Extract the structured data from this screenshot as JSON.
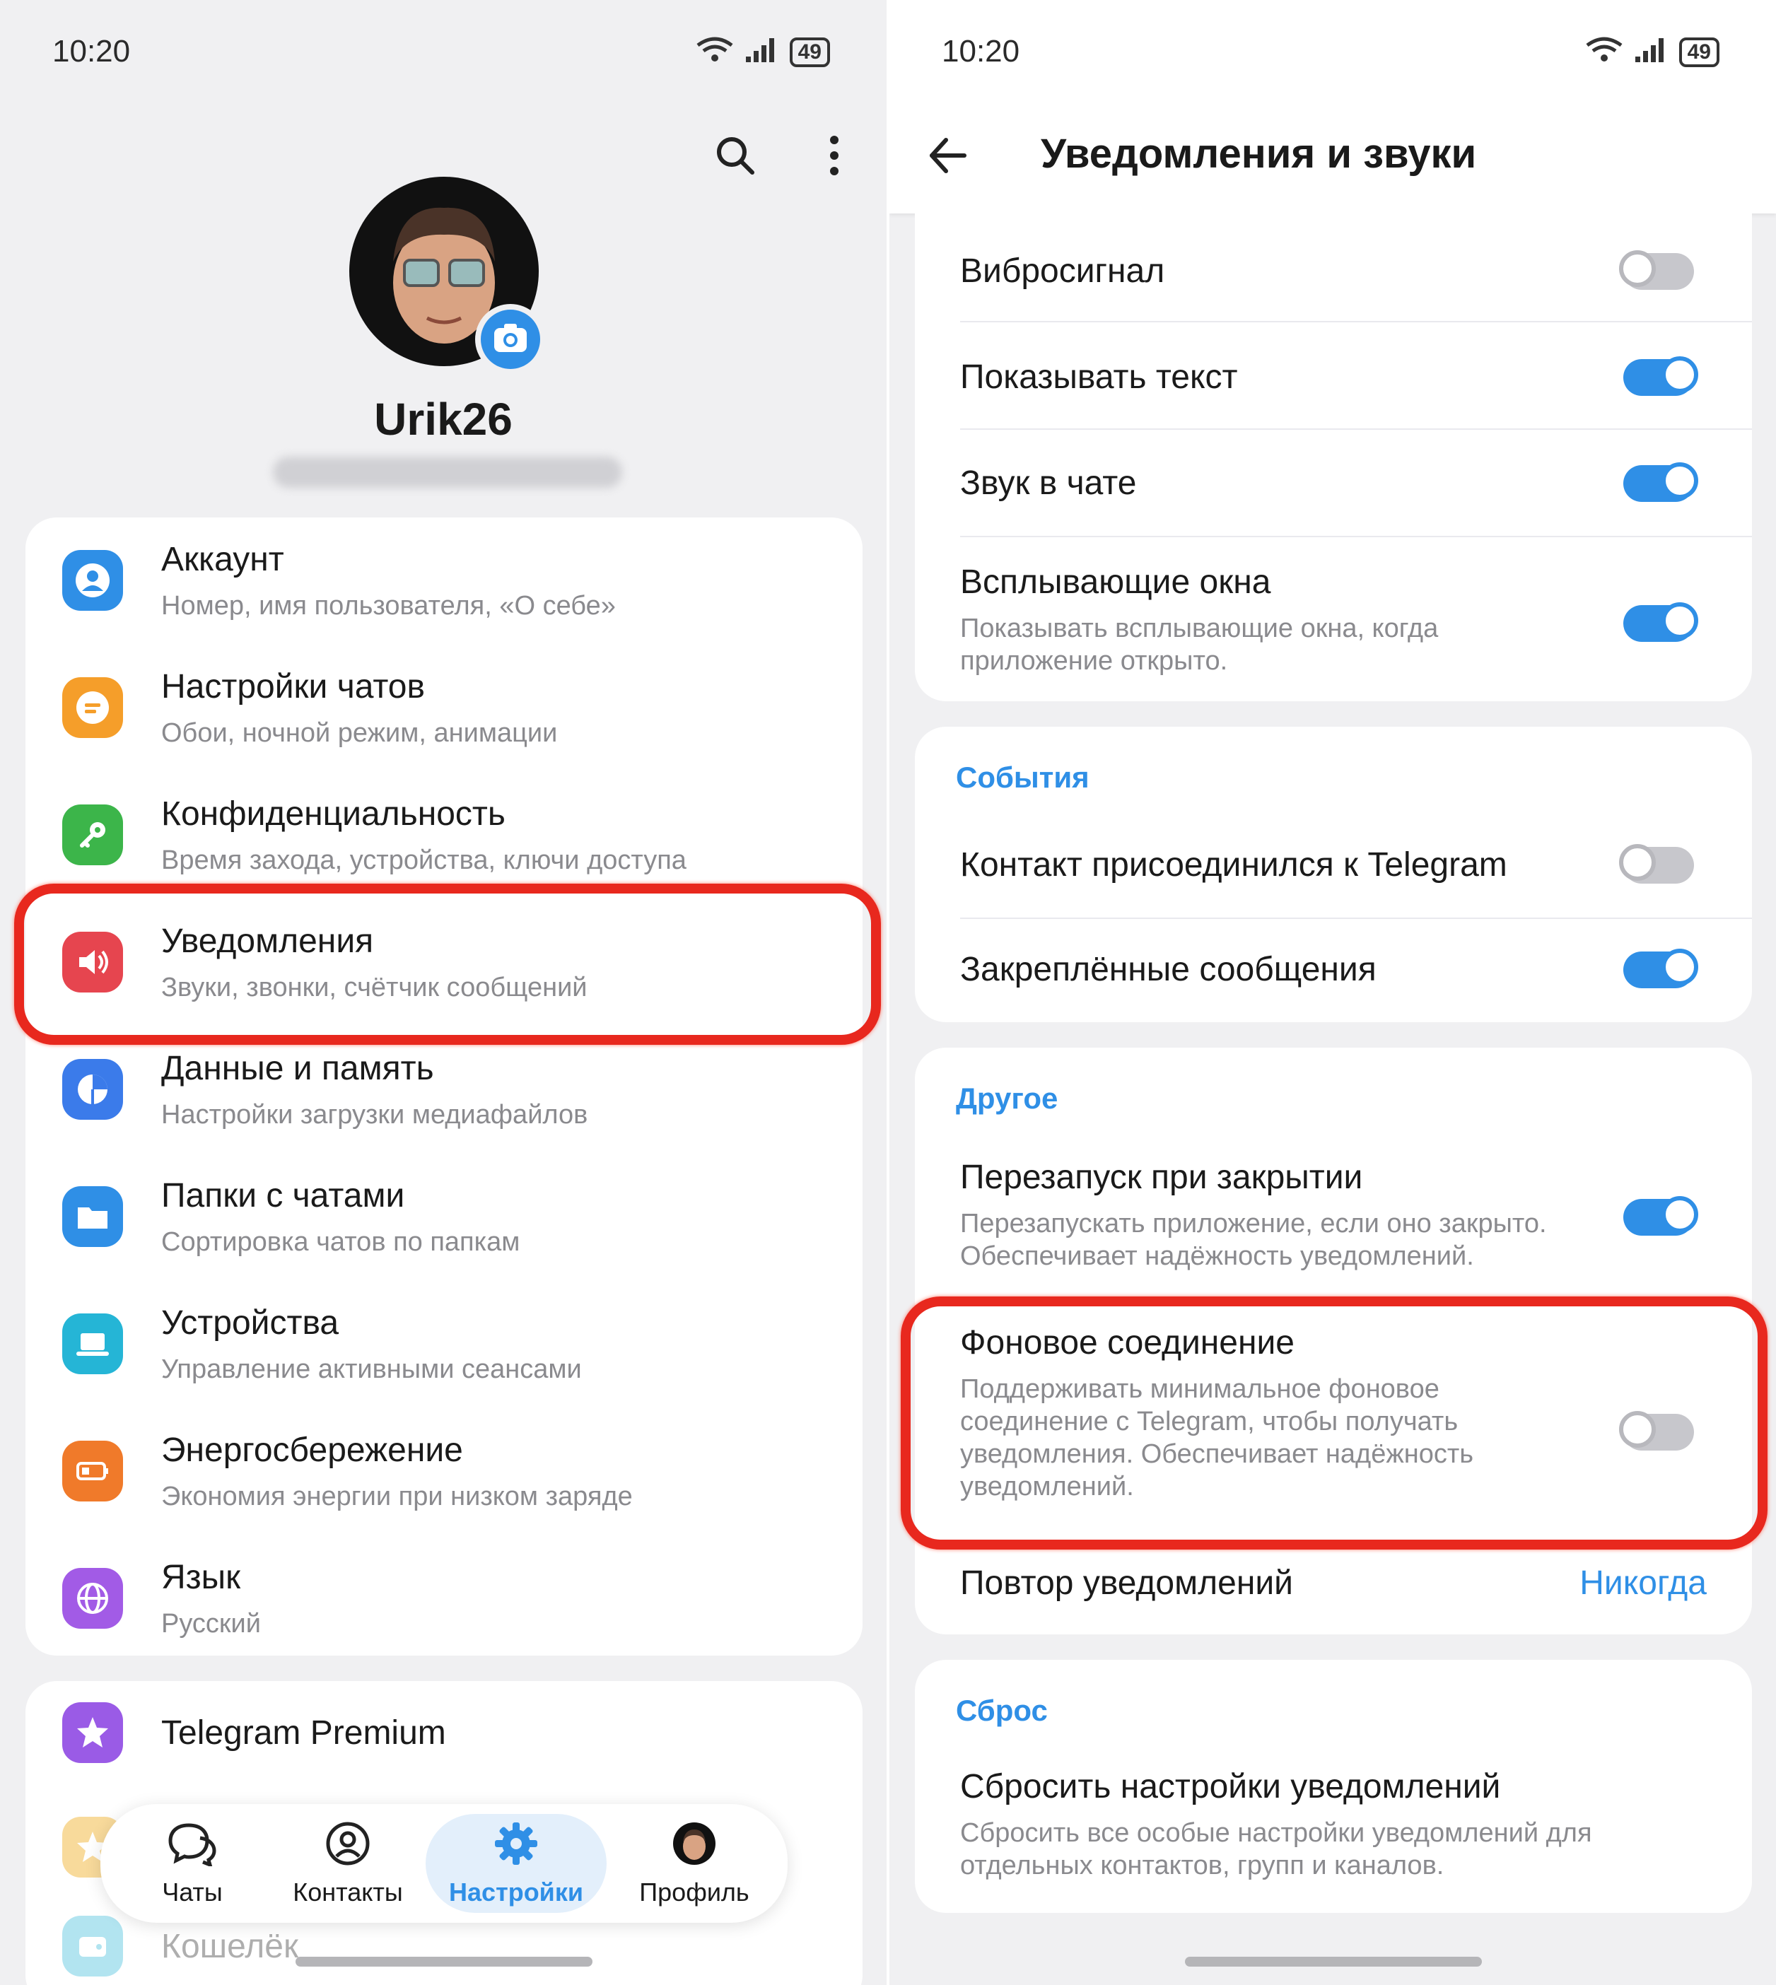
{
  "status_bar": {
    "time": "10:20",
    "battery": "49",
    "signal_label": "6"
  },
  "left": {
    "profile": {
      "name": "Urik26"
    },
    "settings_items": [
      {
        "title": "Аккаунт",
        "subtitle": "Номер, имя пользователя, «О себе»",
        "icon": "person-icon",
        "color": "#2f8fe6"
      },
      {
        "title": "Настройки чатов",
        "subtitle": "Обои, ночной режим, анимации",
        "icon": "chat-bubble-icon",
        "color": "#f59e2a"
      },
      {
        "title": "Конфиденциальность",
        "subtitle": "Время захода, устройства, ключи доступа",
        "icon": "key-icon",
        "color": "#3cb54a"
      },
      {
        "title": "Уведомления",
        "subtitle": "Звуки, звонки, счётчик сообщений",
        "icon": "speaker-icon",
        "color": "#e6454f"
      },
      {
        "title": "Данные и память",
        "subtitle": "Настройки загрузки медиафайлов",
        "icon": "pie-chart-icon",
        "color": "#3b7bea"
      },
      {
        "title": "Папки с чатами",
        "subtitle": "Сортировка чатов по папкам",
        "icon": "folder-icon",
        "color": "#2f8fe6"
      },
      {
        "title": "Устройства",
        "subtitle": "Управление активными сеансами",
        "icon": "laptop-icon",
        "color": "#25b5d6"
      },
      {
        "title": "Энергосбережение",
        "subtitle": "Экономия энергии при низком заряде",
        "icon": "battery-icon",
        "color": "#f07a2a"
      },
      {
        "title": "Язык",
        "subtitle": "Русский",
        "icon": "globe-icon",
        "color": "#a25be6"
      }
    ],
    "premium_items": [
      {
        "title": "Telegram Premium",
        "icon": "star-icon",
        "color": "#9a5be6"
      },
      {
        "title": "Кошелёк",
        "icon": "wallet-icon",
        "color": "#25b5d6"
      }
    ],
    "nav": {
      "items": [
        {
          "label": "Чаты",
          "icon": "chats-icon"
        },
        {
          "label": "Контакты",
          "icon": "contacts-icon"
        },
        {
          "label": "Настройки",
          "icon": "settings-gear-icon"
        },
        {
          "label": "Профиль",
          "icon": "profile-avatar-icon"
        }
      ],
      "active": "Настройки"
    }
  },
  "right": {
    "header_title": "Уведомления и звуки",
    "group1": [
      {
        "title": "Вибросигнал",
        "toggle": "off"
      },
      {
        "title": "Показывать текст",
        "toggle": "on"
      },
      {
        "title": "Звук в чате",
        "toggle": "on"
      },
      {
        "title": "Всплывающие окна",
        "subtitle": "Показывать всплывающие окна, когда приложение открыто.",
        "toggle": "on"
      }
    ],
    "events": {
      "section": "События",
      "items": [
        {
          "title": "Контакт присоединился к Telegram",
          "toggle": "off"
        },
        {
          "title": "Закреплённые сообщения",
          "toggle": "on"
        }
      ]
    },
    "other": {
      "section": "Другое",
      "restart": {
        "title": "Перезапуск при закрытии",
        "subtitle": "Перезапускать приложение, если оно закрыто. Обеспечивает надёжность уведомлений.",
        "toggle": "on"
      },
      "background": {
        "title": "Фоновое соединение",
        "subtitle": "Поддерживать минимальное фоновое соединение с Telegram, чтобы получать уведомления. Обеспечивает надёжность уведомлений.",
        "toggle": "off"
      },
      "repeat": {
        "title": "Повтор уведомлений",
        "value": "Никогда"
      }
    },
    "reset": {
      "section": "Сброс",
      "title": "Сбросить настройки уведомлений",
      "subtitle": "Сбросить все особые настройки уведомлений для отдельных контактов, групп и каналов."
    }
  },
  "colors": {
    "accent": "#2f8fe6",
    "highlight": "#e8281e"
  }
}
